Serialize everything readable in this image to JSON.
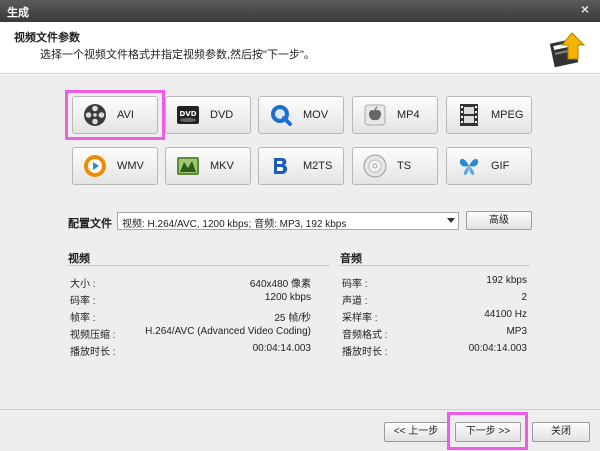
{
  "window": {
    "title": "生成",
    "close_glyph": "×"
  },
  "header": {
    "title": "视频文件参数",
    "subtitle": "选择一个视频文件格式并指定视频参数,然后按\"下一步\"。"
  },
  "formats": [
    {
      "label": "AVI",
      "icon": "film-reel-icon",
      "selected": true
    },
    {
      "label": "DVD",
      "icon": "dvd-icon",
      "selected": false
    },
    {
      "label": "MOV",
      "icon": "quicktime-icon",
      "selected": false
    },
    {
      "label": "MP4",
      "icon": "apple-icon",
      "selected": false
    },
    {
      "label": "MPEG",
      "icon": "film-strip-icon",
      "selected": false
    },
    {
      "label": "WMV",
      "icon": "windows-media-icon",
      "selected": false
    },
    {
      "label": "MKV",
      "icon": "mkv-icon",
      "selected": false
    },
    {
      "label": "M2TS",
      "icon": "bluray-icon",
      "selected": false
    },
    {
      "label": "TS",
      "icon": "disc-icon",
      "selected": false
    },
    {
      "label": "GIF",
      "icon": "butterfly-icon",
      "selected": false
    }
  ],
  "profile": {
    "label": "配置文件",
    "value": "视频: H.264/AVC, 1200 kbps; 音频: MP3, 192 kbps",
    "advanced_label": "高级"
  },
  "video": {
    "title": "视频",
    "rows": [
      {
        "key": "大小 :",
        "value": "640x480 像素"
      },
      {
        "key": "码率 :",
        "value": "1200 kbps"
      },
      {
        "key": "帧率 :",
        "value": "25 帧/秒"
      },
      {
        "key": "视频压缩 :",
        "value": "H.264/AVC (Advanced Video Coding)"
      },
      {
        "key": "播放时长 :",
        "value": "00:04:14.003"
      }
    ]
  },
  "audio": {
    "title": "音频",
    "rows": [
      {
        "key": "码率 :",
        "value": "192 kbps"
      },
      {
        "key": "声道 :",
        "value": "2"
      },
      {
        "key": "采样率 :",
        "value": "44100 Hz"
      },
      {
        "key": "音频格式 :",
        "value": "MP3"
      },
      {
        "key": "播放时长 :",
        "value": "00:04:14.003"
      }
    ]
  },
  "footer": {
    "prev_label": "<< 上一步",
    "next_label": "下一步 >>",
    "close_label": "关闭"
  },
  "colors": {
    "highlight": "#f05ce8",
    "titlebar": "#4a4a4a"
  }
}
